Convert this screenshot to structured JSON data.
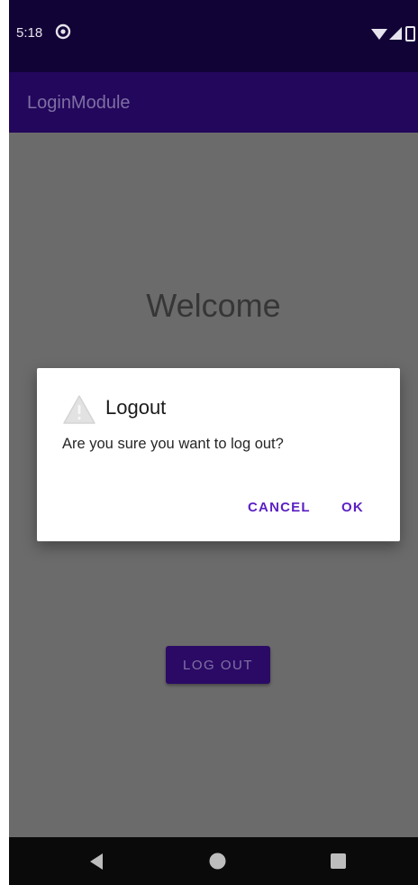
{
  "status_bar": {
    "time": "5:18",
    "icons": [
      "app-notification-icon",
      "wifi-icon",
      "signal-icon",
      "battery-icon"
    ]
  },
  "app_bar": {
    "title": "LoginModule"
  },
  "main": {
    "welcome_text": "Welcome",
    "logout_button_label": "LOG OUT"
  },
  "dialog": {
    "icon": "warning-icon",
    "title": "Logout",
    "message": "Are you sure you want to log out?",
    "cancel_label": "CANCEL",
    "ok_label": "OK"
  },
  "navigation": {
    "icons": [
      "back-icon",
      "home-icon",
      "recents-icon"
    ]
  },
  "colors": {
    "status_bar": "#120336",
    "app_bar": "#23075c",
    "scrim_background": "#6b6b6b",
    "accent": "#5b1fc4"
  }
}
